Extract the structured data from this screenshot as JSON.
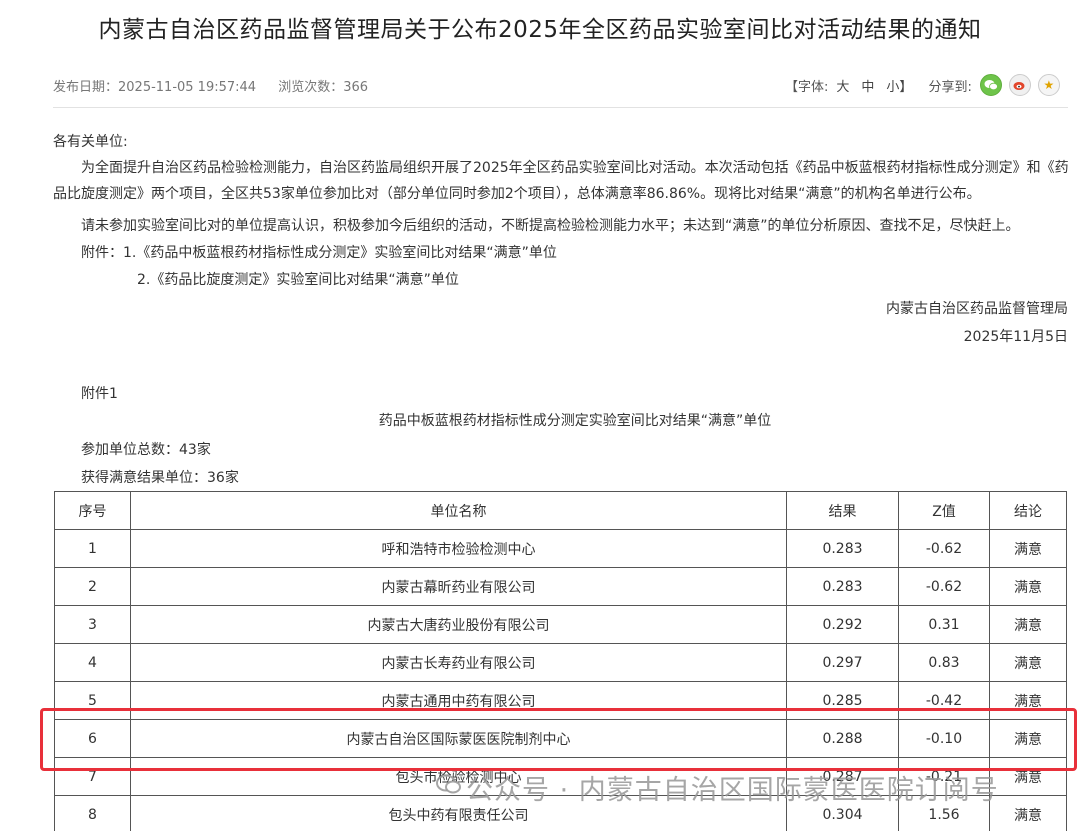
{
  "article": {
    "title": "内蒙古自治区药品监督管理局关于公布2025年全区药品实验室间比对活动结果的通知",
    "publish_date": "发布日期：2025-11-05 19:57:44",
    "views": "浏览次数：366"
  },
  "toolbar": {
    "font_label": "【字体:",
    "font_large": "大",
    "font_medium": "中",
    "font_small": "小】",
    "share_label": "分享到:",
    "wechat_icon": "wechat-icon",
    "weibo_icon": "weibo-icon",
    "favorite_icon": "star-icon"
  },
  "body": {
    "greeting": "各有关单位:",
    "para1": "为全面提升自治区药品检验检测能力，自治区药监局组织开展了2025年全区药品实验室间比对活动。本次活动包括《药品中板蓝根药材指标性成分测定》和《药品比旋度测定》两个项目，全区共53家单位参加比对（部分单位同时参加2个项目），总体满意率86.86%。现将比对结果“满意”的机构名单进行公布。",
    "para2": "请未参加实验室间比对的单位提高认识，积极参加今后组织的活动，不断提高检验检测能力水平；未达到“满意”的单位分析原因、查找不足，尽快赶上。",
    "attachment1": "附件：1.《药品中板蓝根药材指标性成分测定》实验室间比对结果“满意”单位",
    "attachment2": "2.《药品比旋度测定》实验室间比对结果“满意”单位",
    "signature_org": "内蒙古自治区药品监督管理局",
    "signature_date": "2025年11月5日"
  },
  "attachment": {
    "label": "附件1",
    "table_title": "药品中板蓝根药材指标性成分测定实验室间比对结果“满意”单位",
    "total_units": "参加单位总数：43家",
    "satisfied_units": "获得满意结果单位：36家",
    "headers": [
      "序号",
      "单位名称",
      "结果",
      "Z值",
      "结论"
    ],
    "rows": [
      [
        "1",
        "呼和浩特市检验检测中心",
        "0.283",
        "-0.62",
        "满意"
      ],
      [
        "2",
        "内蒙古幕昕药业有限公司",
        "0.283",
        "-0.62",
        "满意"
      ],
      [
        "3",
        "内蒙古大唐药业股份有限公司",
        "0.292",
        "0.31",
        "满意"
      ],
      [
        "4",
        "内蒙古长寿药业有限公司",
        "0.297",
        "0.83",
        "满意"
      ],
      [
        "5",
        "内蒙古通用中药有限公司",
        "0.285",
        "-0.42",
        "满意"
      ],
      [
        "6",
        "内蒙古自治区国际蒙医医院制剂中心",
        "0.288",
        "-0.10",
        "满意"
      ],
      [
        "7",
        "包头市检验检测中心",
        "0.287",
        "-0.21",
        "满意"
      ],
      [
        "8",
        "包头中药有限责任公司",
        "0.304",
        "1.56",
        "满意"
      ]
    ]
  },
  "watermark": {
    "text": "公众号 · 内蒙古自治区国际蒙医医院订阅号"
  },
  "colors": {
    "highlight": "#e8303a",
    "wechat": "#6ec44a"
  }
}
